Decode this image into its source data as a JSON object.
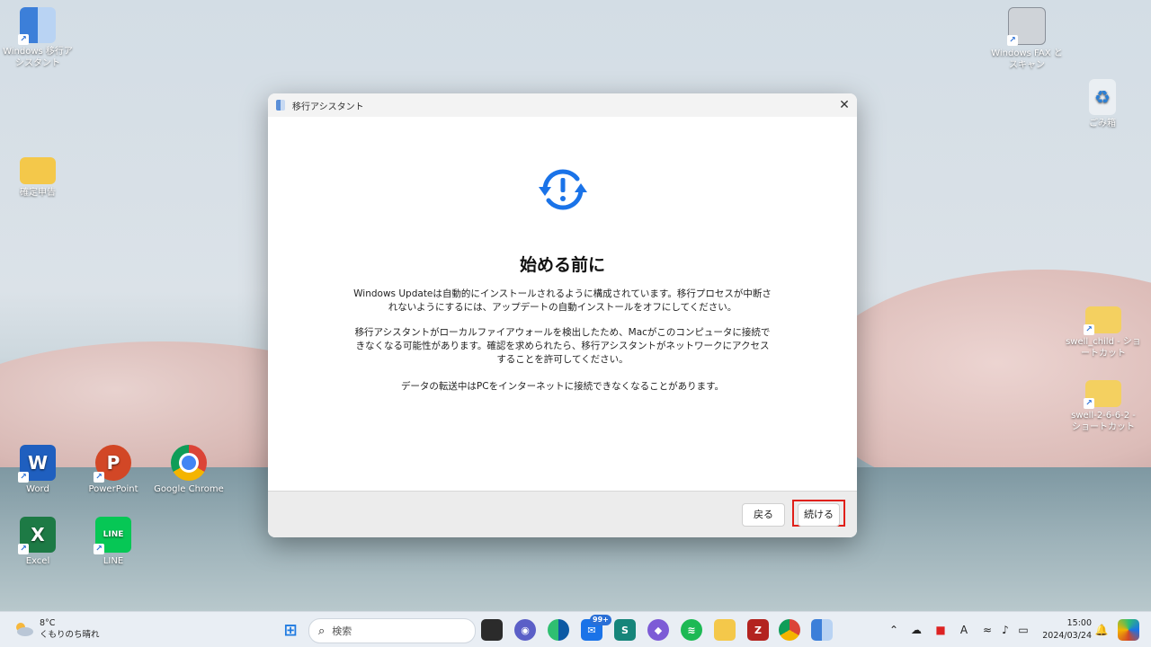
{
  "desktop": {
    "icons": [
      {
        "label": "Windows 移行アシスタント"
      },
      {
        "label": "確定申告"
      },
      {
        "label": "Windows FAX とスキャン"
      },
      {
        "label": "ごみ箱"
      },
      {
        "label": "swell_child - ショートカット"
      },
      {
        "label": "swell-2-6-6-2 - ショートカット"
      },
      {
        "label": "Word"
      },
      {
        "label": "PowerPoint"
      },
      {
        "label": "Google Chrome"
      },
      {
        "label": "Excel"
      },
      {
        "label": "LINE"
      }
    ]
  },
  "dialog": {
    "title": "移行アシスタント",
    "close_glyph": "✕",
    "heading": "始める前に",
    "paragraphs": [
      "Windows Updateは自動的にインストールされるように構成されています。移行プロセスが中断されないようにするには、アップデートの自動インストールをオフにしてください。",
      "移行アシスタントがローカルファイアウォールを検出したため、Macがこのコンピュータに接続できなくなる可能性があります。確認を求められたら、移行アシスタントがネットワークにアクセスすることを許可してください。",
      "データの転送中はPCをインターネットに接続できなくなることがあります。"
    ],
    "back_label": "戻る",
    "continue_label": "続ける",
    "accent_color": "#1a73e8",
    "highlight_color": "#e0201a"
  },
  "taskbar": {
    "weather": {
      "temp": "8°C",
      "condition": "くもりのち晴れ"
    },
    "search_placeholder": "検索",
    "mail_badge": "99+",
    "clock": {
      "time": "15:00",
      "date": "2024/03/24"
    },
    "ime_label": "A"
  }
}
